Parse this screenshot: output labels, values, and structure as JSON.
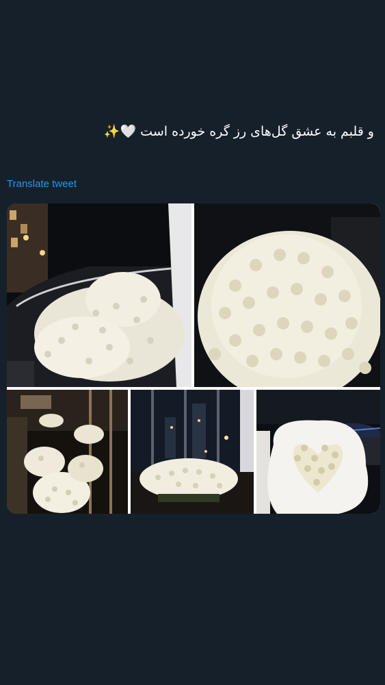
{
  "tweet": {
    "text": "و قلبم به عشق گل‌های رز گره خورده است 🤍✨",
    "translate_label": "Translate tweet"
  },
  "media": {
    "photos": [
      {
        "icon": "white-roses-in-car-trunk"
      },
      {
        "icon": "white-rose-dome-bouquet"
      },
      {
        "icon": "white-roses-in-lobby"
      },
      {
        "icon": "white-roses-by-night-window"
      },
      {
        "icon": "white-rose-heart-bouquet-in-car"
      }
    ]
  },
  "colors": {
    "background": "#16202b",
    "link": "#1d9bf0",
    "text": "#ffffff"
  }
}
